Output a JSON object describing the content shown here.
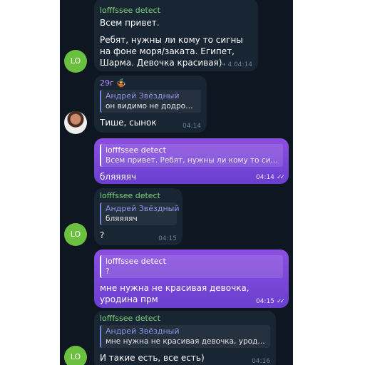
{
  "messages": [
    {
      "sender": "lofffssee detect",
      "text_a": "Всем привет.",
      "text_b": "Ребят, нужны ли кому то сигны на фоне моря/заката. Египет, Шарма. Девочка красивая)",
      "reply_count": "4",
      "time": "04:14",
      "avatar": "LO"
    },
    {
      "sender": "29г 🤹",
      "reply_name": "Андрей Звёздный",
      "reply_text": "он видимо не додрочил",
      "text": "Тише, сынок",
      "time": "04:14"
    },
    {
      "reply_name": "lofffssee detect",
      "reply_text": "Всем привет.  Ребят, нужны ли кому то сигн...",
      "text": "бляяяяч",
      "time": "04:14"
    },
    {
      "sender": "lofffssee detect",
      "reply_name": "Андрей Звёздный",
      "reply_text": "бляяяяч",
      "text": "?",
      "time": "04:15",
      "avatar": "LO"
    },
    {
      "reply_name": "lofffssee detect",
      "reply_text": "?",
      "text": "мне нужна не красивая девочка, уродина прм",
      "time": "04:15"
    },
    {
      "sender": "lofffssee detect",
      "reply_name": "Андрей Звёздный",
      "reply_text": "мне нужна не красивая девочка, уродин...",
      "text": "И такие есть, все есть)",
      "time": "04:16",
      "avatar": "LO"
    }
  ],
  "icons": {
    "reply_arrow": "↪",
    "double_check": "✓✓"
  },
  "colors": {
    "chat_bg": "#0e1621",
    "incoming_bubble": "#182533",
    "outgoing_bubble": "#7b4ad8",
    "sender_name": "#7fd67a",
    "avatar_green": "#6bc040"
  }
}
